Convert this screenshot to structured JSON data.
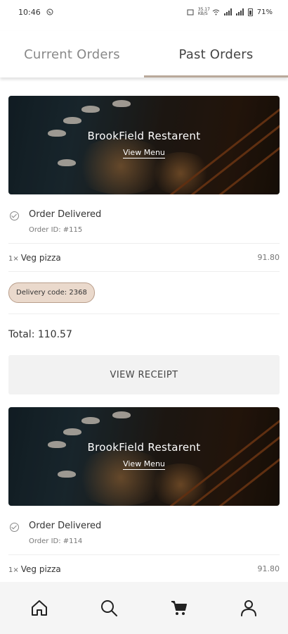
{
  "status_bar": {
    "time": "10:46",
    "net_speed": "35.17 KB/S",
    "battery": "71%"
  },
  "tabs": [
    {
      "label": "Current Orders",
      "active": false
    },
    {
      "label": "Past Orders",
      "active": true
    }
  ],
  "orders": [
    {
      "restaurant": "BrookField Restarent",
      "view_menu": "View Menu",
      "status": "Order Delivered",
      "order_id": "Order ID: #115",
      "item_qty": "1×",
      "item_name": "Veg pizza",
      "item_price": "91.80",
      "delivery_code": "Delivery code: 2368",
      "total": "Total: 110.57",
      "receipt_label": "VIEW RECEIPT"
    },
    {
      "restaurant": "BrookField Restarent",
      "view_menu": "View Menu",
      "status": "Order Delivered",
      "order_id": "Order ID: #114",
      "item_qty": "1×",
      "item_name": "Veg pizza",
      "item_price": "91.80"
    }
  ],
  "bottom_nav": [
    {
      "icon": "home-icon"
    },
    {
      "icon": "search-icon"
    },
    {
      "icon": "cart-icon"
    },
    {
      "icon": "profile-icon"
    }
  ],
  "colors": {
    "accent": "#b9a99a",
    "badge_bg": "#ead9cc",
    "button_bg": "#f2f2f2"
  }
}
